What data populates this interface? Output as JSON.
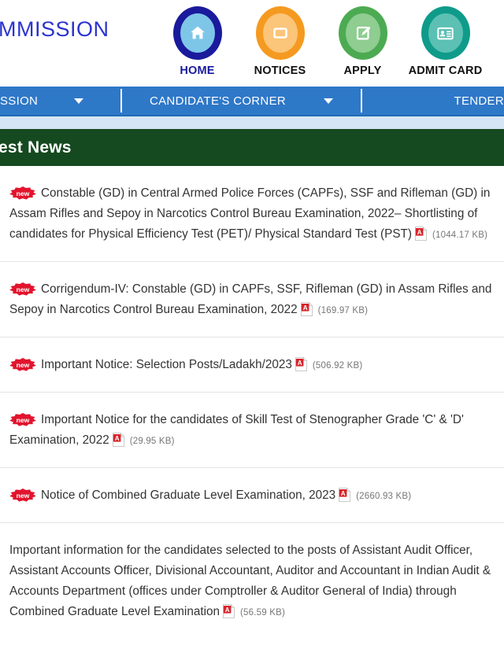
{
  "header": {
    "brand_text": "MMISSION",
    "quicklinks": [
      {
        "label": "HOME",
        "icon": "home-icon",
        "ring_color": "#1a1a9c",
        "fill_color": "#7ec6e8",
        "label_color": "#1a1a9c"
      },
      {
        "label": "NOTICES",
        "icon": "notices-icon",
        "ring_color": "#f59a20",
        "fill_color": "#fbc57a",
        "label_color": "#111111"
      },
      {
        "label": "APPLY",
        "icon": "apply-icon",
        "ring_color": "#4cab52",
        "fill_color": "#8fcd91",
        "label_color": "#111111"
      },
      {
        "label": "ADMIT CARD",
        "icon": "admit-card-icon",
        "ring_color": "#0f9b8a",
        "fill_color": "#5cc0b4",
        "label_color": "#111111"
      }
    ]
  },
  "navbar": {
    "background": "#2e78c8",
    "items": [
      {
        "label": "SSION",
        "has_caret": true
      },
      {
        "label": "CANDIDATE'S CORNER",
        "has_caret": true
      },
      {
        "label": "TENDER",
        "has_caret": false
      }
    ]
  },
  "news_banner": {
    "title": "est News",
    "background": "#154a20"
  },
  "news_list": [
    {
      "new_badge": "new",
      "text": "Constable (GD) in Central Armed Police Forces (CAPFs), SSF and Rifleman (GD) in Assam Rifles and Sepoy in Narcotics Control Bureau Examination, 2022– Shortlisting of candidates for Physical Efficiency Test (PET)/ Physical Standard Test (PST)",
      "pdf": "pdf-icon",
      "filesize": "(1044.17 KB)"
    },
    {
      "new_badge": "new",
      "text": "Corrigendum-IV: Constable (GD) in CAPFs, SSF, Rifleman (GD) in Assam Rifles and Sepoy in Narcotics Control Bureau Examination, 2022",
      "pdf": "pdf-icon",
      "filesize": "(169.97 KB)"
    },
    {
      "new_badge": "new",
      "text": "Important Notice: Selection Posts/Ladakh/2023",
      "pdf": "pdf-icon",
      "filesize": "(506.92 KB)"
    },
    {
      "new_badge": "new",
      "text": "Important Notice for the candidates of Skill Test of Stenographer Grade 'C' & 'D' Examination, 2022",
      "pdf": "pdf-icon",
      "filesize": "(29.95 KB)"
    },
    {
      "new_badge": "new",
      "text": "Notice of Combined Graduate Level Examination, 2023",
      "pdf": "pdf-icon",
      "filesize": "(2660.93 KB)"
    },
    {
      "new_badge": "",
      "text": "Important information for the candidates selected to the posts of Assistant Audit Officer, Assistant Accounts Officer, Divisional Accountant, Auditor and Accountant in Indian Audit & Accounts Department (offices under Comptroller & Auditor General of India) through Combined Graduate Level Examination",
      "pdf": "pdf-icon",
      "filesize": "(56.59 KB)"
    }
  ]
}
